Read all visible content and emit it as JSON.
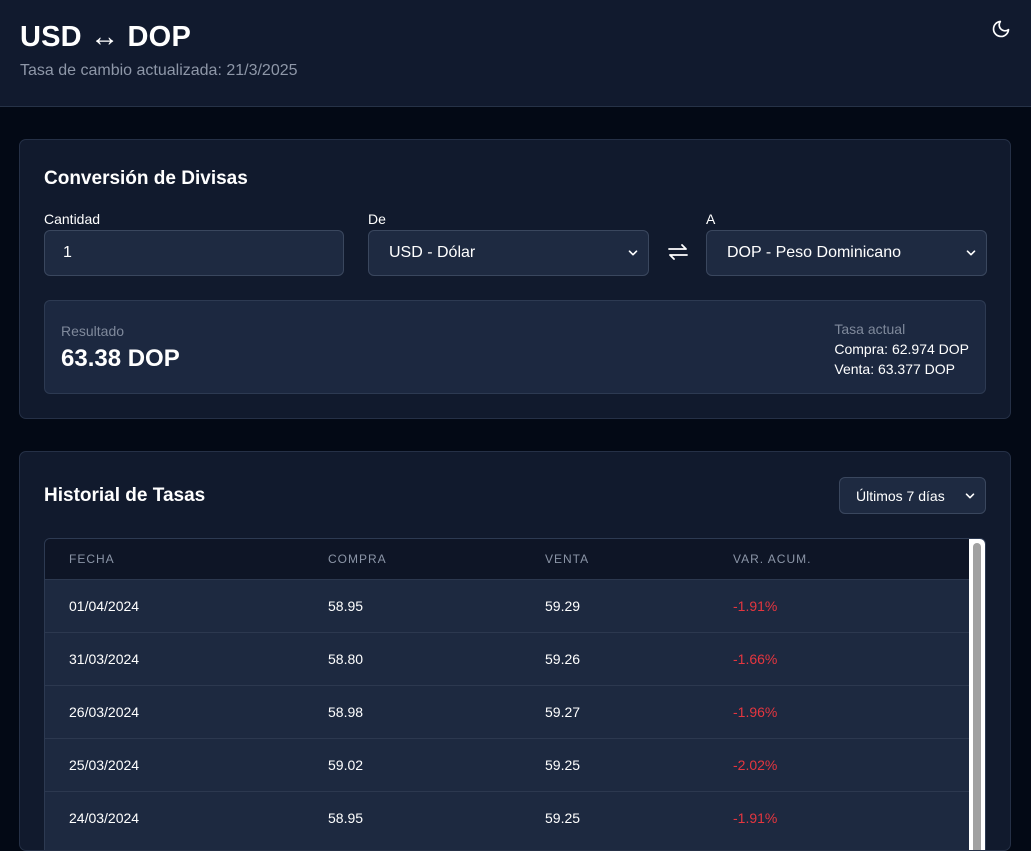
{
  "header": {
    "title": "USD ↔ DOP",
    "subtitle": "Tasa de cambio actualizada: 21/3/2025",
    "theme_icon": "moon-icon"
  },
  "converter": {
    "title": "Conversión de Divisas",
    "amount_label": "Cantidad",
    "amount_value": "1",
    "from_label": "De",
    "from_selected": "USD - Dólar",
    "to_label": "A",
    "to_selected": "DOP - Peso Dominicano",
    "swap_icon": "swap-arrows-icon",
    "result_label": "Resultado",
    "result_value": "63.38 DOP",
    "rate_title": "Tasa actual",
    "rate_buy": "Compra: 62.974 DOP",
    "rate_sell": "Venta: 63.377 DOP"
  },
  "history": {
    "title": "Historial de Tasas",
    "period_selected": "Últimos 7 días",
    "columns": [
      "FECHA",
      "COMPRA",
      "VENTA",
      "VAR. ACUM."
    ],
    "rows": [
      {
        "fecha": "01/04/2024",
        "compra": "58.95",
        "venta": "59.29",
        "var": "-1.91%"
      },
      {
        "fecha": "31/03/2024",
        "compra": "58.80",
        "venta": "59.26",
        "var": "-1.66%"
      },
      {
        "fecha": "26/03/2024",
        "compra": "58.98",
        "venta": "59.27",
        "var": "-1.96%"
      },
      {
        "fecha": "25/03/2024",
        "compra": "59.02",
        "venta": "59.25",
        "var": "-2.02%"
      },
      {
        "fecha": "24/03/2024",
        "compra": "58.95",
        "venta": "59.25",
        "var": "-1.91%"
      }
    ]
  },
  "colors": {
    "negative": "#e5363f",
    "background": "#030915",
    "card": "#111a2d",
    "input": "#1e2a41"
  }
}
